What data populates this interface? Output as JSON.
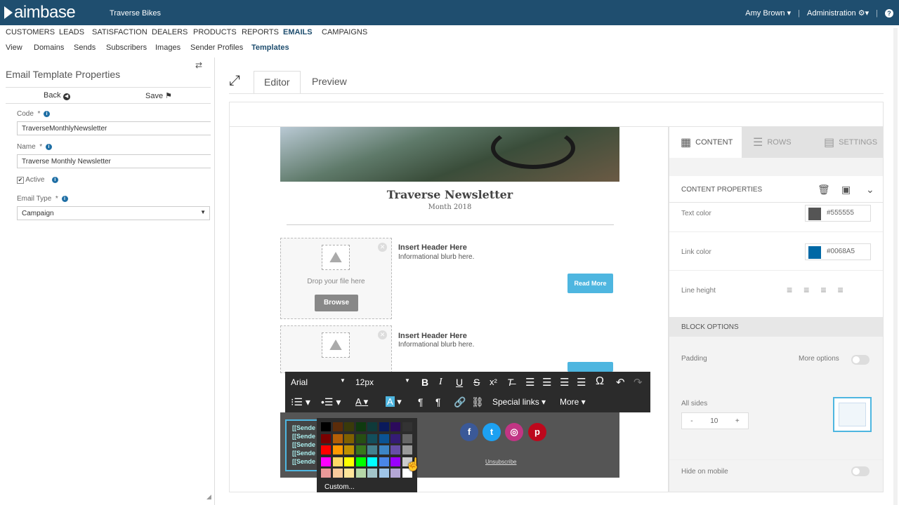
{
  "topbar": {
    "logo": "aimbase",
    "company": "Traverse Bikes",
    "user": "Amy Brown",
    "admin": "Administration"
  },
  "nav_main": [
    "CUSTOMERS",
    "LEADS",
    "SATISFACTION",
    "DEALERS",
    "PRODUCTS",
    "REPORTS",
    "EMAILS",
    "CAMPAIGNS"
  ],
  "nav_sub": [
    "View",
    "Domains",
    "Sends",
    "Subscribers",
    "Images",
    "Sender Profiles",
    "Templates"
  ],
  "left": {
    "title": "Email Template Properties",
    "back": "Back",
    "save": "Save",
    "code_label": "Code",
    "code_value": "TraverseMonthlyNewsletter",
    "name_label": "Name",
    "name_value": "Traverse Monthly Newsletter",
    "active_label": "Active",
    "type_label": "Email Type",
    "type_value": "Campaign"
  },
  "editor": {
    "tab_editor": "Editor",
    "tab_preview": "Preview"
  },
  "newsletter": {
    "title": "Traverse Newsletter",
    "date": "Month 2018",
    "header": "Insert Header Here",
    "blurb": "Informational blurb here.",
    "drop": "Drop your file here",
    "browse": "Browse",
    "read_more": "Read More",
    "sender": "[[Sende",
    "unsubscribe": "Unsubscribe"
  },
  "toolbar": {
    "font": "Arial",
    "size": "12px",
    "special": "Special links",
    "more": "More",
    "custom": "Custom..."
  },
  "right": {
    "tab_content": "CONTENT",
    "tab_rows": "ROWS",
    "tab_settings": "SETTINGS",
    "content_props": "CONTENT PROPERTIES",
    "text_color": "Text color",
    "text_color_val": "#555555",
    "link_color": "Link color",
    "link_color_val": "#0068A5",
    "line_height": "Line height",
    "block_options": "BLOCK OPTIONS",
    "padding": "Padding",
    "more_options": "More options",
    "all_sides": "All sides",
    "padding_val": "10",
    "hide_mobile": "Hide on mobile",
    "minus": "-",
    "plus": "+"
  },
  "colors": {
    "text": "#555555",
    "link": "#0068A5",
    "topbar": "#1f4e6f",
    "accent": "#4eb6e0"
  }
}
